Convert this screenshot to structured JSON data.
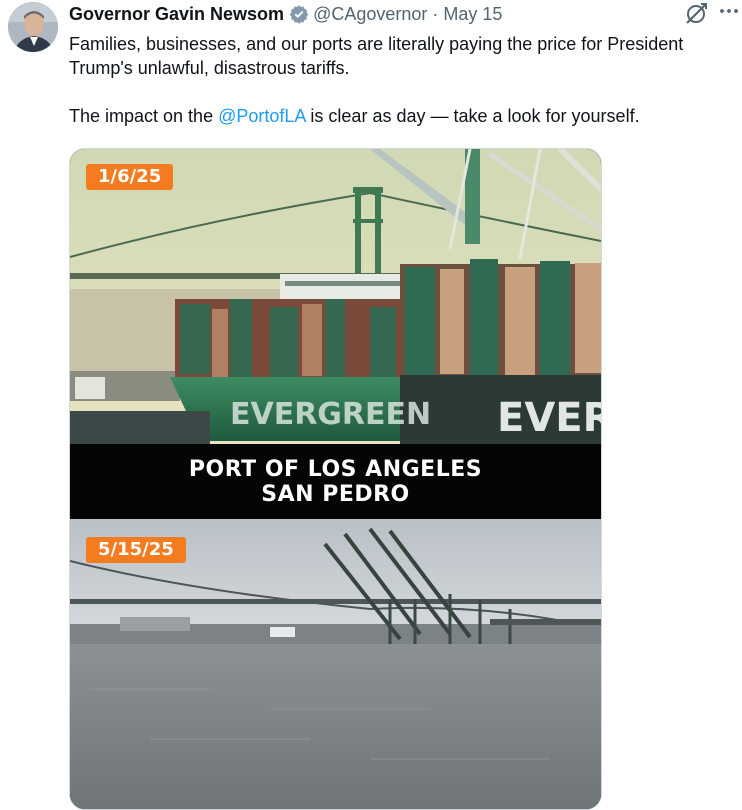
{
  "tweet": {
    "author_name": "Governor Gavin Newsom",
    "handle": "@CAgovernor",
    "separator": "·",
    "date": "May 15",
    "text_line1": "Families, businesses, and our ports are literally paying the price for President Trump's unlawful, disastrous tariffs.",
    "text_p2_before": "The impact on the ",
    "mention": "@PortofLA",
    "text_p2_after": " is clear as day — take a look for yourself."
  },
  "media": {
    "top_date": "1/6/25",
    "caption_line1": "PORT OF LOS ANGELES",
    "caption_line2": "SAN PEDRO",
    "bottom_date": "5/15/25",
    "hull_text": "EVERGRE",
    "hull_text_bow": "EVERGREEN"
  },
  "icons": {
    "verified": "verified-badge-icon",
    "grok": "grok-icon",
    "more": "more-options-icon"
  },
  "colors": {
    "link": "#1d9bf0",
    "secondary_text": "#536471",
    "badge_orange": "#f47b20",
    "verified_gray": "#829aab"
  }
}
